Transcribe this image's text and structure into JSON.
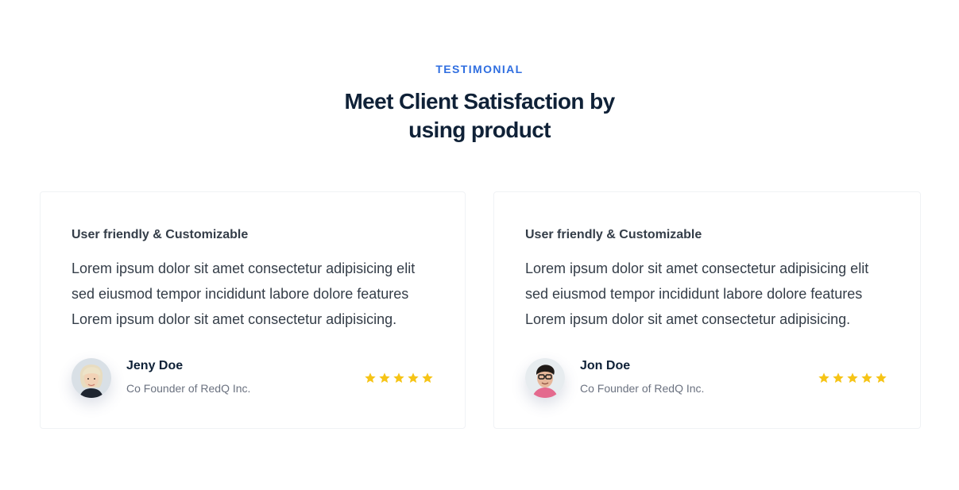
{
  "section": {
    "tag": "TESTIMONIAL",
    "title_line1": "Meet Client Satisfaction by",
    "title_line2": "using product"
  },
  "testimonials": [
    {
      "heading": "User friendly & Customizable",
      "text": "Lorem ipsum dolor sit amet consectetur adipisicing elit sed eiusmod tempor incididunt labore dolore features Lorem ipsum dolor sit amet consectetur adipisicing.",
      "name": "Jeny Doe",
      "role": "Co Founder of RedQ Inc.",
      "rating": 5,
      "avatar_icon": "woman-avatar"
    },
    {
      "heading": "User friendly & Customizable",
      "text": "Lorem ipsum dolor sit amet consectetur adipisicing elit sed eiusmod tempor incididunt labore dolore features Lorem ipsum dolor sit amet consectetur adipisicing.",
      "name": "Jon Doe",
      "role": "Co Founder of RedQ Inc.",
      "rating": 5,
      "avatar_icon": "man-avatar"
    }
  ],
  "colors": {
    "accent": "#2f6ee0",
    "heading": "#0f2137",
    "body": "#343d48",
    "star": "#f6c416"
  }
}
